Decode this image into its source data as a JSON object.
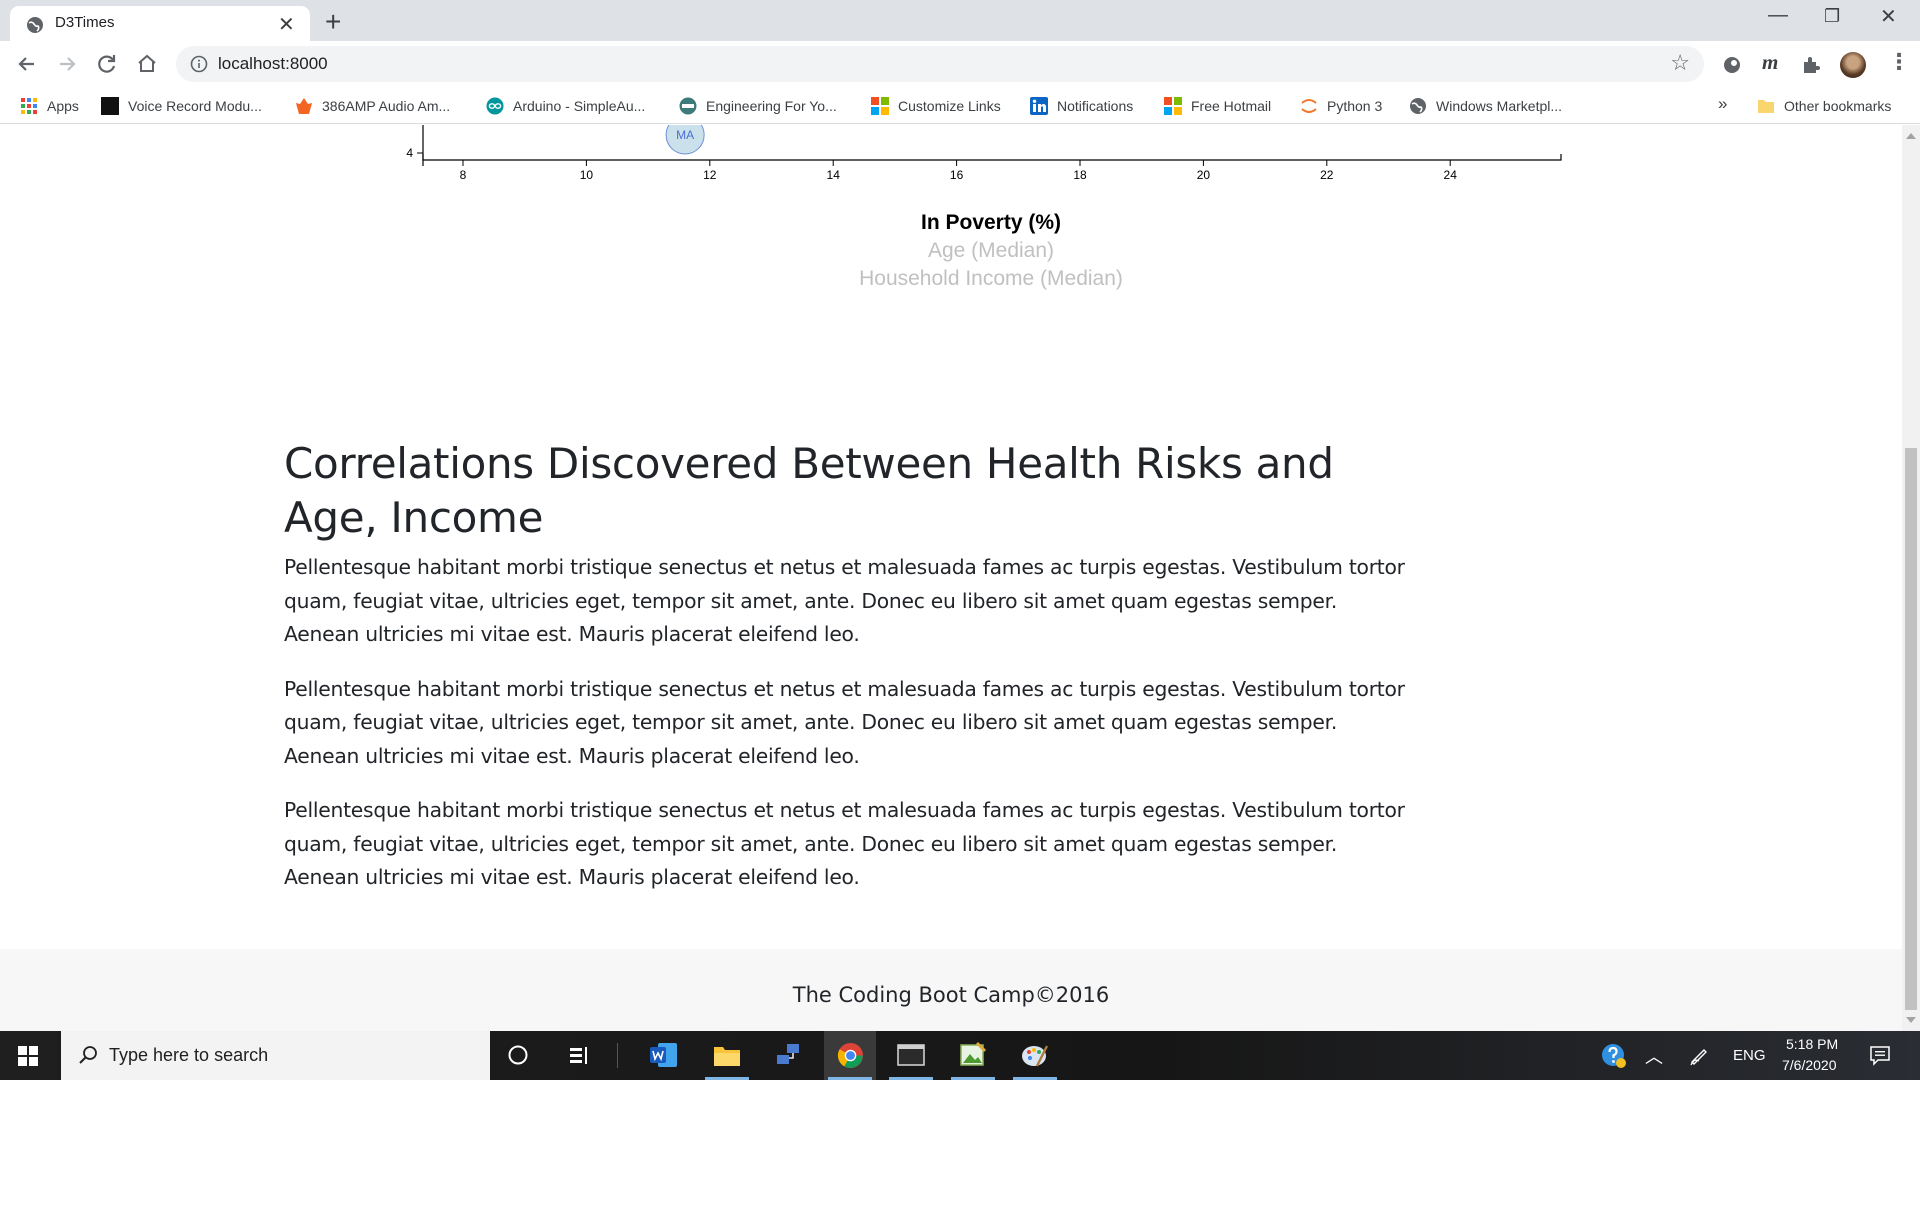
{
  "browser": {
    "tab_title": "D3Times",
    "tab_close": "✕",
    "new_tab": "+",
    "url": "localhost:8000",
    "window_controls": {
      "minimize": "—",
      "restore": "❐",
      "close": "✕"
    },
    "bookmarks": [
      {
        "label": "Apps",
        "icon": "apps-grid-icon"
      },
      {
        "label": "Voice Record Modu...",
        "icon": "chip-icon"
      },
      {
        "label": "386AMP Audio Am...",
        "icon": "flame-icon"
      },
      {
        "label": "Arduino - SimpleAu...",
        "icon": "arduino-icon"
      },
      {
        "label": "Engineering For Yo...",
        "icon": "engineering-icon"
      },
      {
        "label": "Customize Links",
        "icon": "microsoft-icon"
      },
      {
        "label": "Notifications",
        "icon": "linkedin-icon"
      },
      {
        "label": "Free Hotmail",
        "icon": "microsoft-icon"
      },
      {
        "label": "Python 3",
        "icon": "jupyter-icon"
      },
      {
        "label": "Windows Marketpl...",
        "icon": "globe-icon"
      }
    ],
    "bookmarks_overflow": "»",
    "other_bookmarks": "Other bookmarks"
  },
  "chart_data": {
    "type": "scatter",
    "x_ticks": [
      "8",
      "10",
      "12",
      "14",
      "16",
      "18",
      "20",
      "22",
      "24"
    ],
    "y_ticks": [
      "4"
    ],
    "points": [
      {
        "label": "MA",
        "x": 11.6,
        "y": 4.3
      }
    ],
    "x_axis_labels": [
      {
        "text": "In Poverty (%)",
        "active": true
      },
      {
        "text": "Age (Median)",
        "active": false
      },
      {
        "text": "Household Income (Median)",
        "active": false
      }
    ],
    "marker_color": "#89bdd3"
  },
  "article": {
    "title": "Correlations Discovered Between Health Risks and Age, Income",
    "paragraphs": [
      "Pellentesque habitant morbi tristique senectus et netus et malesuada fames ac turpis egestas. Vestibulum tortor quam, feugiat vitae, ultricies eget, tempor sit amet, ante. Donec eu libero sit amet quam egestas semper. Aenean ultricies mi vitae est. Mauris placerat eleifend leo.",
      "Pellentesque habitant morbi tristique senectus et netus et malesuada fames ac turpis egestas. Vestibulum tortor quam, feugiat vitae, ultricies eget, tempor sit amet, ante. Donec eu libero sit amet quam egestas semper. Aenean ultricies mi vitae est. Mauris placerat eleifend leo.",
      "Pellentesque habitant morbi tristique senectus et netus et malesuada fames ac turpis egestas. Vestibulum tortor quam, feugiat vitae, ultricies eget, tempor sit amet, ante. Donec eu libero sit amet quam egestas semper. Aenean ultricies mi vitae est. Mauris placerat eleifend leo."
    ]
  },
  "footer": {
    "text": "The Coding Boot Camp©2016"
  },
  "taskbar": {
    "search_placeholder": "Type here to search",
    "language": "ENG",
    "time": "5:18 PM",
    "date": "7/6/2020",
    "apps": [
      "word-icon",
      "file-explorer-icon",
      "network-icon",
      "chrome-icon",
      "terminal-icon",
      "image-editor-icon",
      "paint-icon"
    ]
  }
}
